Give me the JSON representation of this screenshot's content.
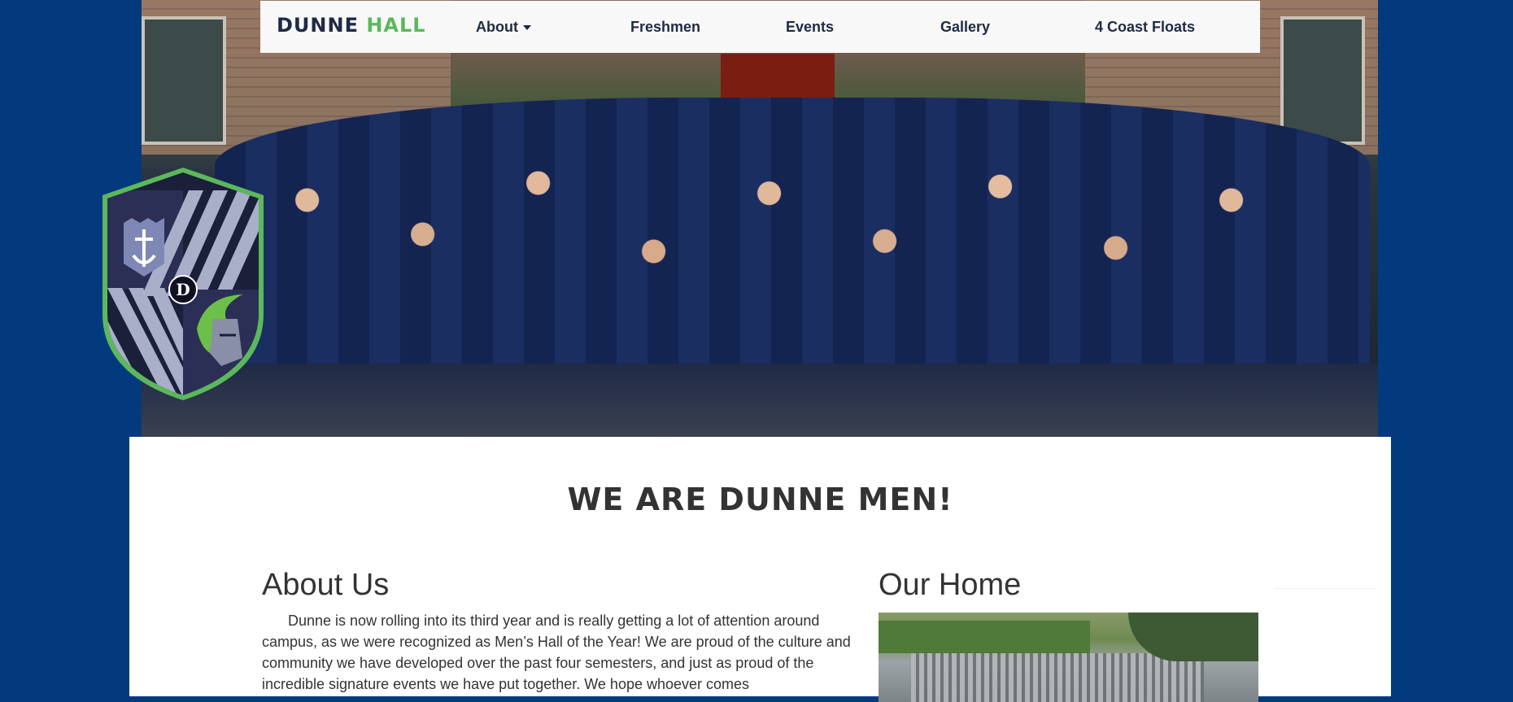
{
  "brand": {
    "part1": "DUNNE",
    "part2": "HALL"
  },
  "nav": {
    "items": [
      {
        "label": "About",
        "dropdown": true
      },
      {
        "label": "Freshmen"
      },
      {
        "label": "Events"
      },
      {
        "label": "Gallery"
      },
      {
        "label": "4 Coast Floats"
      }
    ]
  },
  "crest": {
    "letter": "D"
  },
  "main": {
    "headline": "WE ARE DUNNE MEN!",
    "about": {
      "title": "About Us",
      "text": "Dunne is now rolling into its third year and is really getting a lot of attention around campus, as we were recognized as Men’s Hall of the Year! We are proud of the culture and community we have developed over the past four semesters, and just as proud of the incredible signature events we have put together. We hope whoever comes"
    },
    "home": {
      "title": "Our Home"
    }
  },
  "colors": {
    "page_bg": "#023a7d",
    "brand_dark": "#1f2a44",
    "brand_green": "#5cb85c",
    "navbar_bg": "#f8f8f8",
    "text": "#333333"
  }
}
